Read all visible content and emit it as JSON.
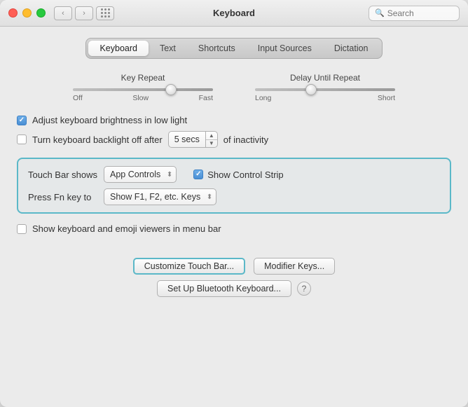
{
  "window": {
    "title": "Keyboard"
  },
  "search": {
    "placeholder": "Search"
  },
  "tabs": [
    {
      "label": "Keyboard",
      "active": true
    },
    {
      "label": "Text",
      "active": false
    },
    {
      "label": "Shortcuts",
      "active": false
    },
    {
      "label": "Input Sources",
      "active": false
    },
    {
      "label": "Dictation",
      "active": false
    }
  ],
  "sliders": {
    "key_repeat": {
      "label": "Key Repeat",
      "left": "Off",
      "left2": "Slow",
      "right": "Fast"
    },
    "delay": {
      "label": "Delay Until Repeat",
      "left": "Long",
      "right": "Short"
    }
  },
  "options": {
    "brightness": {
      "label": "Adjust keyboard brightness in low light",
      "checked": true
    },
    "backlight": {
      "label": "Turn keyboard backlight off after",
      "checked": false,
      "stepper_value": "5 secs",
      "suffix": "of inactivity"
    }
  },
  "touchbar": {
    "show_label": "Touch Bar shows",
    "show_value": "App Controls",
    "show_control_strip": {
      "label": "Show Control Strip",
      "checked": true
    },
    "fn_label": "Press Fn key to",
    "fn_value": "Show F1, F2, etc. Keys"
  },
  "emoji_row": {
    "label": "Show keyboard and emoji viewers in menu bar",
    "checked": false
  },
  "buttons": {
    "customize": "Customize Touch Bar...",
    "modifier": "Modifier Keys...",
    "bluetooth": "Set Up Bluetooth Keyboard..."
  }
}
